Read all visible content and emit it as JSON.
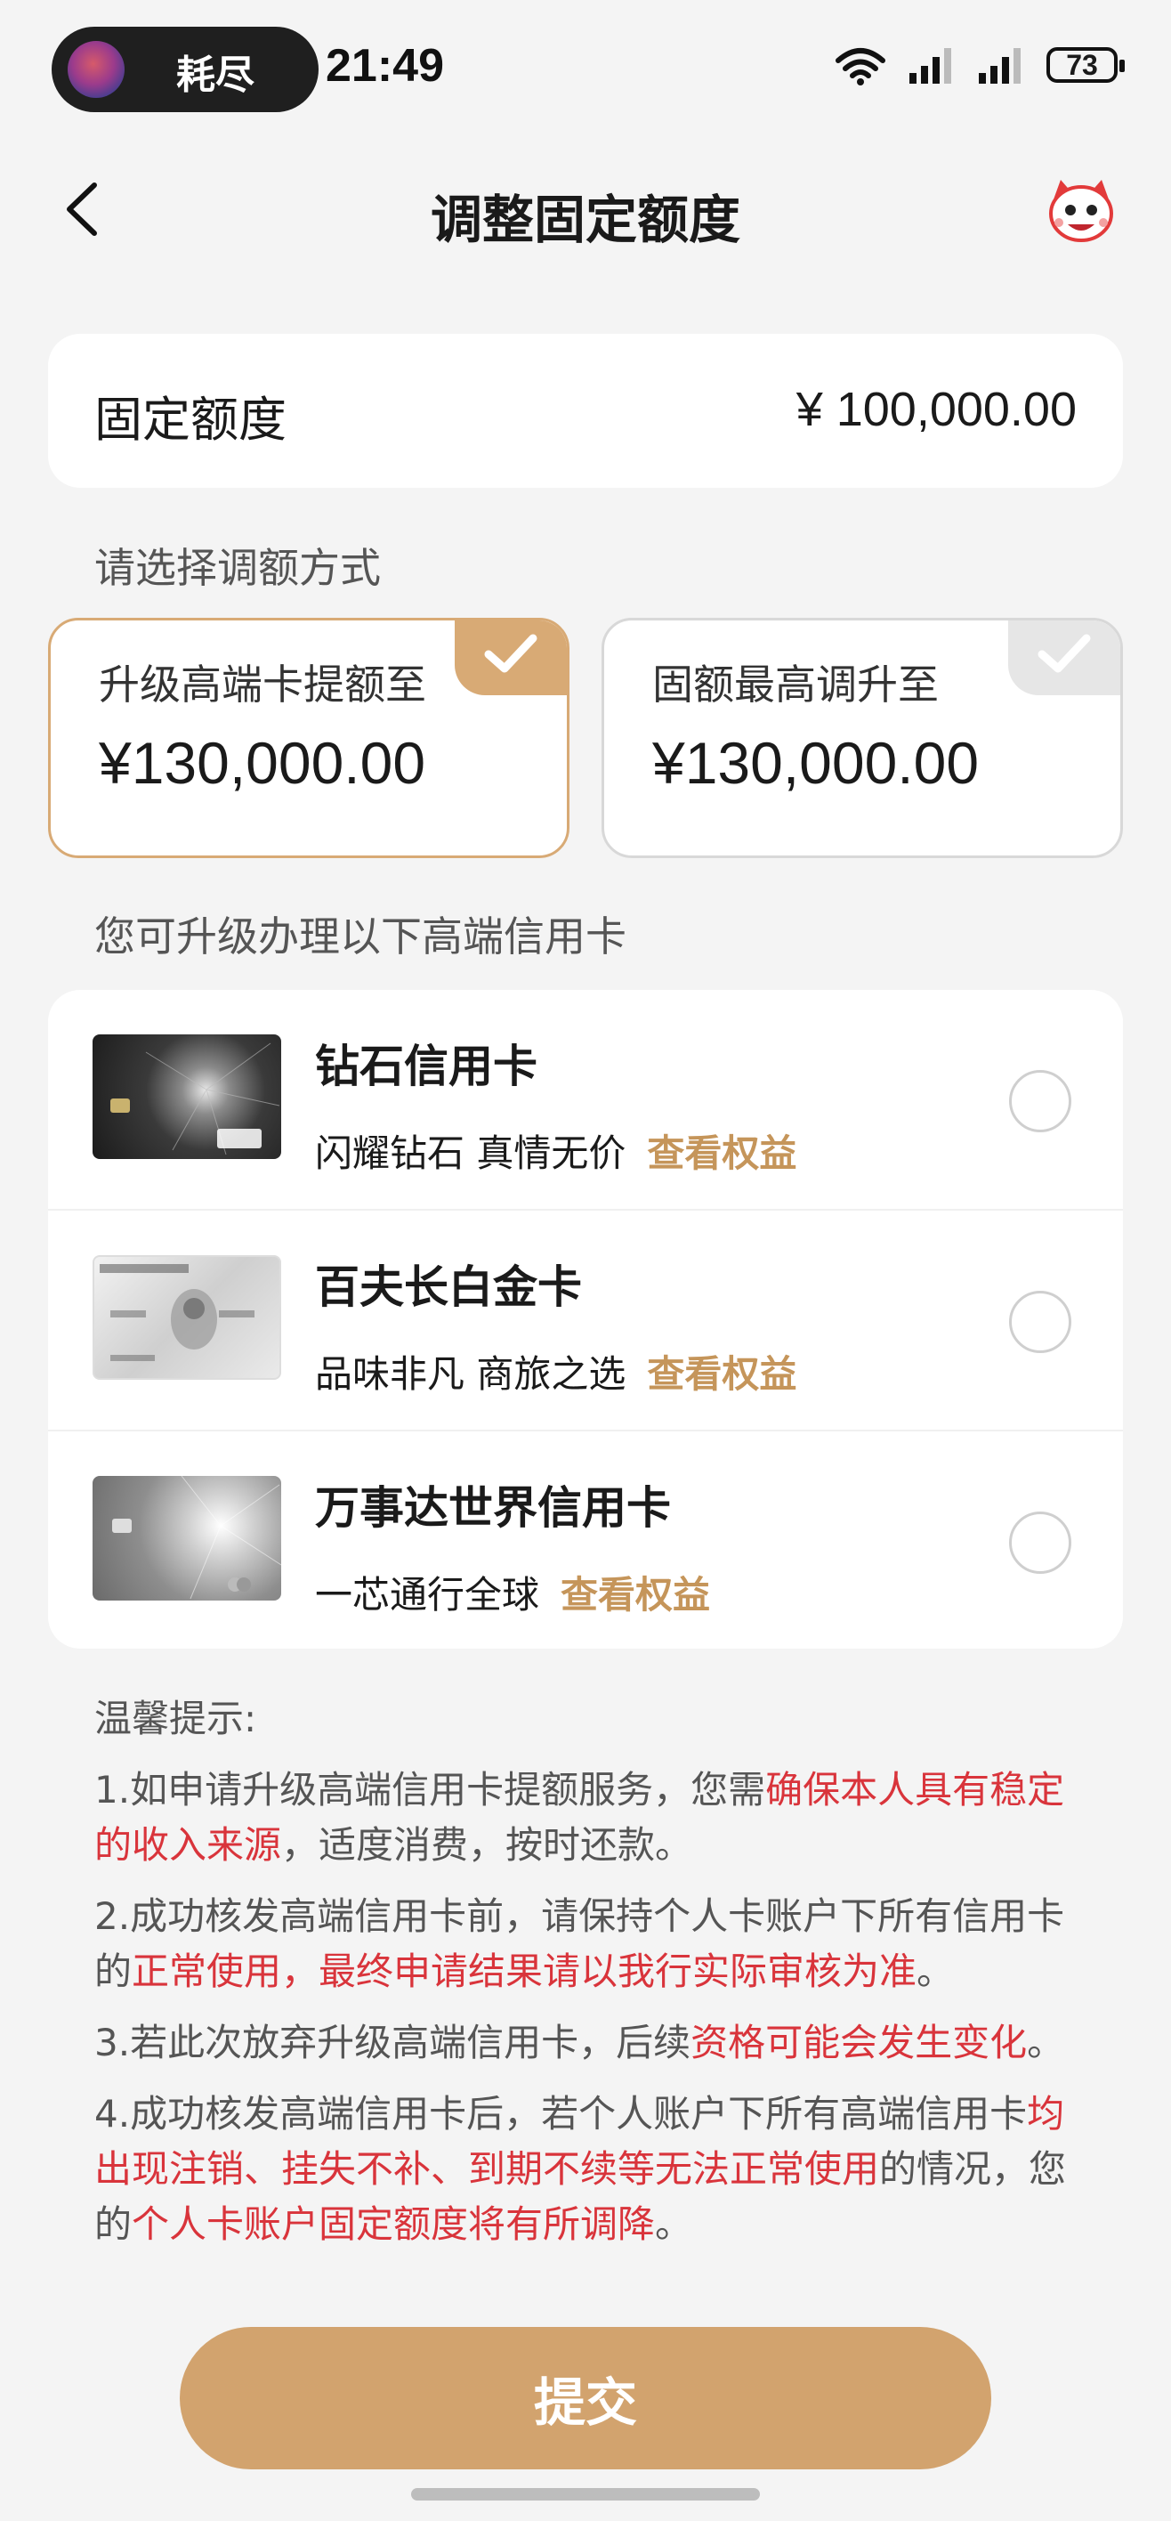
{
  "status_bar": {
    "pill_text": "耗尽",
    "time": "21:49",
    "battery": "73"
  },
  "nav": {
    "title": "调整固定额度"
  },
  "fixed_quota": {
    "label": "固定额度",
    "value": "¥ 100,000.00"
  },
  "adjust_section_label": "请选择调额方式",
  "options": [
    {
      "label": "升级高端卡提额至",
      "value": "¥130,000.00",
      "selected": true
    },
    {
      "label": "固额最高调升至",
      "value": "¥130,000.00",
      "selected": false
    }
  ],
  "cards_section_label": "您可升级办理以下高端信用卡",
  "cards": [
    {
      "name": "钻石信用卡",
      "desc": "闪耀钻石 真情无价",
      "link": "查看权益"
    },
    {
      "name": "百夫长白金卡",
      "desc": "品味非凡 商旅之选",
      "link": "查看权益"
    },
    {
      "name": "万事达世界信用卡",
      "desc": "一芯通行全球",
      "link": "查看权益"
    }
  ],
  "tips": {
    "title": "温馨提示:",
    "items": [
      {
        "parts": [
          {
            "t": "1.如申请升级高端信用卡提额服务，您需"
          },
          {
            "t": "确保本人具有稳定的收入来源",
            "hl": true
          },
          {
            "t": "，适度消费，按时还款。"
          }
        ]
      },
      {
        "parts": [
          {
            "t": "2.成功核发高端信用卡前，请保持个人卡账户下所有信用卡的"
          },
          {
            "t": "正常使用，最终申请结果请以我行实际审核为准",
            "hl": true
          },
          {
            "t": "。"
          }
        ]
      },
      {
        "parts": [
          {
            "t": "3.若此次放弃升级高端信用卡，后续"
          },
          {
            "t": "资格可能会发生变化",
            "hl": true
          },
          {
            "t": "。"
          }
        ]
      },
      {
        "parts": [
          {
            "t": "4.成功核发高端信用卡后，若个人账户下所有高端信用卡"
          },
          {
            "t": "均出现注销、挂失不补、到期不续等无法正常使用",
            "hl": true
          },
          {
            "t": "的情况，您的"
          },
          {
            "t": "个人卡账户固定额度将有所调降",
            "hl": true
          },
          {
            "t": "。"
          }
        ]
      }
    ]
  },
  "submit_label": "提交",
  "colors": {
    "accent": "#d2a36e",
    "highlight": "#d9343b",
    "link": "#c5955a"
  }
}
